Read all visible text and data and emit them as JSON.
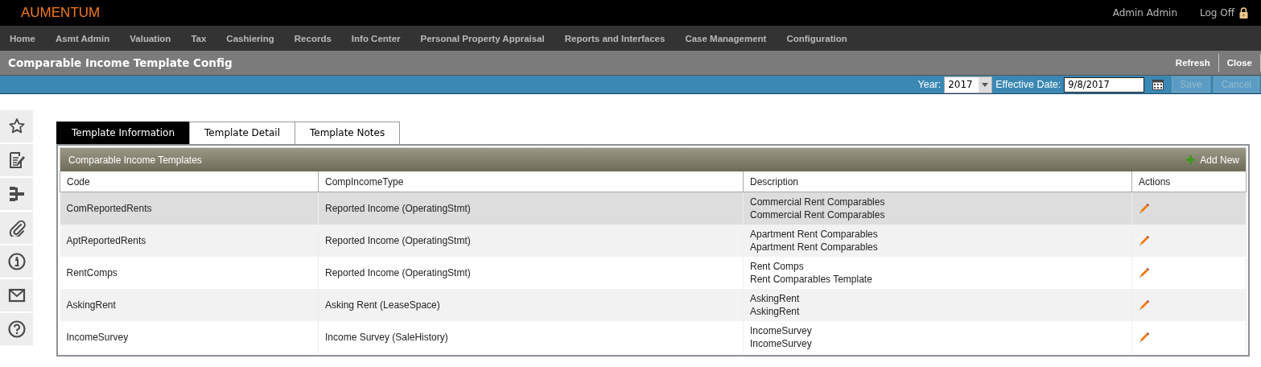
{
  "brand": "AUMENTUM",
  "user": {
    "name": "Admin Admin",
    "logoff": "Log Off"
  },
  "nav": [
    "Home",
    "Asmt Admin",
    "Valuation",
    "Tax",
    "Cashiering",
    "Records",
    "Info Center",
    "Personal Property Appraisal",
    "Reports and Interfaces",
    "Case Management",
    "Configuration"
  ],
  "page_title": "Comparable Income Template Config",
  "title_actions": [
    "Refresh",
    "Close"
  ],
  "filter": {
    "year_label": "Year:",
    "year": "2017",
    "date_label": "Effective Date:",
    "date": "9/8/2017",
    "buttons": [
      {
        "label": "Save",
        "disabled": true
      },
      {
        "label": "Cancel",
        "disabled": true
      }
    ]
  },
  "sidebar": {
    "items": [
      {
        "kind": "star"
      },
      {
        "kind": "note"
      },
      {
        "kind": "tree"
      },
      {
        "kind": "clip"
      },
      {
        "kind": "info"
      },
      {
        "kind": "mail"
      },
      {
        "kind": "help"
      }
    ]
  },
  "tabs": [
    {
      "label": "Template Information",
      "selected": true
    },
    {
      "label": "Template Detail",
      "selected": false
    },
    {
      "label": "Template Notes",
      "selected": false
    }
  ],
  "grid": {
    "title": "Comparable Income Templates",
    "add_label": "Add New",
    "columns": [
      "Code",
      "CompIncomeType",
      "Description",
      "Actions"
    ],
    "rows": [
      {
        "code": "ComReportedRents",
        "type": "Reported Income (OperatingStmt)",
        "description": [
          "Commercial Rent Comparables",
          "Commercial Rent Comparables"
        ],
        "selected": true
      },
      {
        "code": "AptReportedRents",
        "type": "Reported Income (OperatingStmt)",
        "description": [
          "Apartment Rent Comparables",
          "Apartment Rent Comparables"
        ],
        "selected": false
      },
      {
        "code": "RentComps",
        "type": "Reported Income (OperatingStmt)",
        "description": [
          "Rent Comps",
          "Rent Comparables Template"
        ],
        "selected": false
      },
      {
        "code": "AskingRent",
        "type": "Asking Rent (LeaseSpace)",
        "description": [
          "AskingRent",
          "AskingRent"
        ],
        "selected": false
      },
      {
        "code": "IncomeSurvey",
        "type": "Income Survey (SaleHistory)",
        "description": [
          "IncomeSurvey",
          "IncomeSurvey"
        ],
        "selected": false
      }
    ]
  }
}
